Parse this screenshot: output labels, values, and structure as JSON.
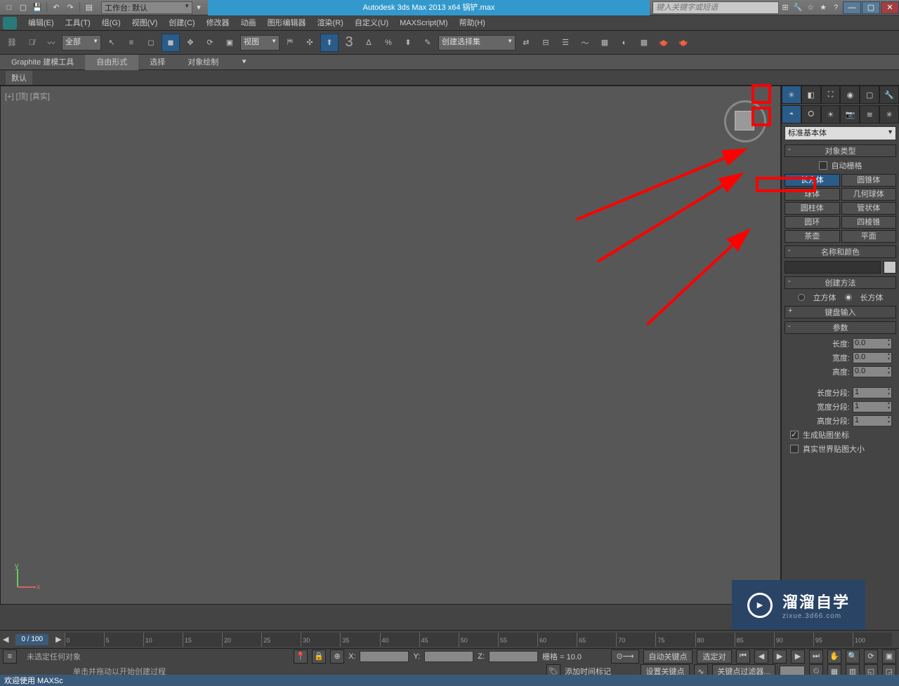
{
  "title": "Autodesk 3ds Max  2013 x64     锅铲.max",
  "workspace": "工作台: 默认",
  "search_placeholder": "键入关键字或短语",
  "menus": [
    "编辑(E)",
    "工具(T)",
    "组(G)",
    "视图(V)",
    "创建(C)",
    "修改器",
    "动画",
    "图形编辑器",
    "渲染(R)",
    "自定义(U)",
    "MAXScript(M)",
    "帮助(H)"
  ],
  "toolbar": {
    "filter_all": "全部",
    "view_dd": "视图",
    "selset_dd": "创建选择集"
  },
  "ribbon": {
    "modeling": "Graphite 建模工具",
    "freeform": "自由形式",
    "select": "选择",
    "paint": "对象绘制",
    "poly_label": "默认"
  },
  "viewport": {
    "label": "[+] [顶] [真实]"
  },
  "cmd": {
    "dd": "标准基本体",
    "rollout_objtype": "对象类型",
    "autogrid": "自动栅格",
    "buttons": [
      [
        "长方体",
        "圆锥体"
      ],
      [
        "球体",
        "几何球体"
      ],
      [
        "圆柱体",
        "管状体"
      ],
      [
        "圆环",
        "四棱锥"
      ],
      [
        "茶壶",
        "平面"
      ]
    ],
    "rollout_name": "名称和颜色",
    "rollout_create": "创建方法",
    "create_cube": "立方体",
    "create_box": "长方体",
    "rollout_kb": "键盘输入",
    "rollout_params": "参数",
    "len": "长度:",
    "wid": "宽度:",
    "hei": "高度:",
    "lseg": "长度分段:",
    "wseg": "宽度分段:",
    "hseg": "高度分段:",
    "v0": "0.0",
    "v1": "1",
    "gen_uv": "生成贴图坐标",
    "real_uv": "真实世界贴图大小"
  },
  "timeline": {
    "marker": "0 / 100",
    "ticks": [
      "0",
      "5",
      "10",
      "15",
      "20",
      "25",
      "30",
      "35",
      "40",
      "45",
      "50",
      "55",
      "60",
      "65",
      "70",
      "75",
      "80",
      "85",
      "90",
      "95",
      "100"
    ]
  },
  "status": {
    "none_selected": "未选定任何对象",
    "hint": "单击并拖动以开始创建过程",
    "grid": "栅格 = 10.0",
    "autokey": "自动关键点",
    "setkey": "设置关键点",
    "selected_only": "选定对",
    "keyfilter": "关键点过滤器...",
    "addtime": "添加时间标记",
    "welcome": "欢迎使用 MAXSc"
  },
  "watermark": {
    "main": "溜溜自学",
    "sub": "zixue.3d66.com"
  },
  "coords": {
    "x": "X:",
    "y": "Y:",
    "z": "Z:"
  }
}
